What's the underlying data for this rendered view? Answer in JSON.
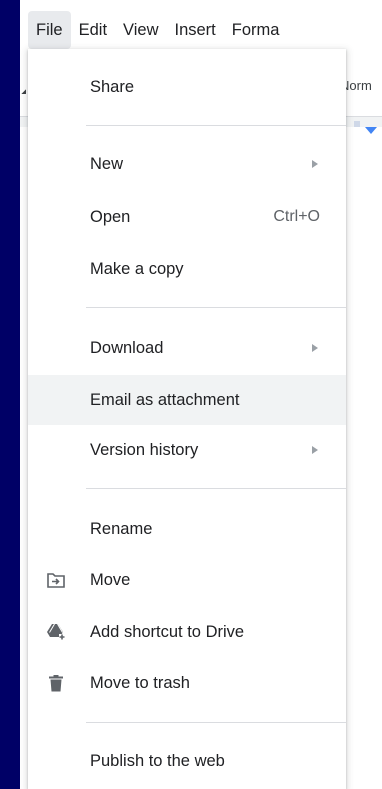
{
  "menubar": {
    "items": [
      "File",
      "Edit",
      "View",
      "Insert",
      "Forma"
    ]
  },
  "toolbar": {
    "style_label": "Norm"
  },
  "file_menu": {
    "share": "Share",
    "new": "New",
    "open": "Open",
    "open_shortcut": "Ctrl+O",
    "make_copy": "Make a copy",
    "download": "Download",
    "email_attachment": "Email as attachment",
    "version_history": "Version history",
    "rename": "Rename",
    "move": "Move",
    "add_shortcut": "Add shortcut to Drive",
    "move_to_trash": "Move to trash",
    "publish": "Publish to the web"
  },
  "icons": {
    "move": "move-folder-icon",
    "add_shortcut": "drive-add-shortcut-icon",
    "trash": "trash-icon",
    "submenu": "chevron-right-icon"
  },
  "colors": {
    "background": "#000066",
    "highlight": "#f1f3f4",
    "ruler_marker": "#4285f4"
  }
}
